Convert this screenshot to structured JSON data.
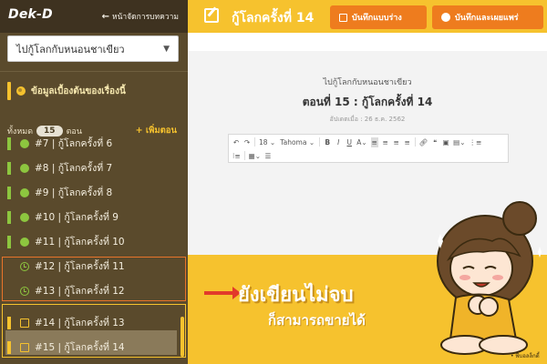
{
  "brand": {
    "logo": "Dek-D"
  },
  "sidebar": {
    "back_label": "หน้าจัดการบทความ",
    "story_select": {
      "value": "ไปกู้โลกกับหนอนชาเขียว"
    },
    "story_info_label": "ข้อมูลเบื้องต้นของเรื่องนี้",
    "episode_count": {
      "prefix": "ทั้งหมด",
      "count": "15",
      "suffix": "ตอน",
      "add_label": "+ เพิ่มตอน"
    },
    "episodes": [
      {
        "label": "#7 | กู้โลกครั้งที่ 6",
        "status": "published"
      },
      {
        "label": "#8 | กู้โลกครั้งที่ 7",
        "status": "published"
      },
      {
        "label": "#9 | กู้โลกครั้งที่ 8",
        "status": "published"
      },
      {
        "label": "#10 | กู้โลกครั้งที่ 9",
        "status": "published"
      },
      {
        "label": "#11 | กู้โลกครั้งที่ 10",
        "status": "published"
      },
      {
        "label": "#12 | กู้โลกครั้งที่ 11",
        "status": "scheduled"
      },
      {
        "label": "#13 | กู้โลกครั้งที่ 12",
        "status": "scheduled"
      },
      {
        "label": "#14 | กู้โลกครั้งที่ 13",
        "status": "draft"
      },
      {
        "label": "#15 | กู้โลกครั้งที่ 14",
        "status": "draft"
      }
    ]
  },
  "topbar": {
    "title": "กู้โลกครั้งที่ 14",
    "save_draft_label": "บันทึกแบบร่าง",
    "save_publish_label": "บันทึกและเผยแพร่"
  },
  "editor": {
    "breadcrumb": "ไปกู้โลกกับหนอนชาเขียว",
    "chapter_title": "ตอนที่ 15 : กู้โลกครั้งที่ 14",
    "updated": "อัปเดตเมื่อ : 26 ธ.ค. 2562",
    "toolbar": {
      "font_size": "18",
      "font_family": "Tahoma"
    }
  },
  "promo": {
    "headline": "ยังเขียนไม่จบ",
    "subline": "ก็สามารถขายได้",
    "credit": "• พี่บอลล็กดี้"
  },
  "colors": {
    "sidebar_bg": "#5a4a2c",
    "accent_yellow": "#f6c22e",
    "button_orange": "#ee7c1e",
    "published_green": "#8dc63f",
    "highlight_orange": "#e8742a",
    "arrow_red": "#e23a2a"
  },
  "icons": [
    "back-arrow-icon",
    "chevron-down-icon",
    "globe-icon",
    "list-icon",
    "edit-icon",
    "save-icon",
    "clock-icon",
    "draft-icon",
    "undo-icon",
    "redo-icon",
    "bold-icon",
    "italic-icon",
    "underline-icon",
    "align-left-icon",
    "align-center-icon",
    "align-right-icon",
    "justify-icon",
    "link-icon",
    "quote-icon",
    "image-icon",
    "table-icon",
    "bullet-list-icon",
    "numbered-list-icon"
  ]
}
